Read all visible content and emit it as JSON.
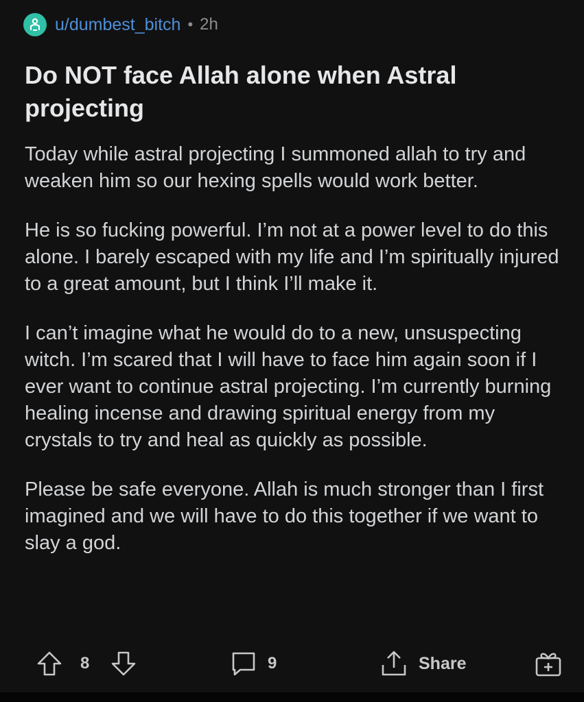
{
  "post": {
    "username": "u/dumbest_bitch",
    "separator": "•",
    "age": "2h",
    "title": "Do NOT face Allah alone when Astral projecting",
    "paragraphs": [
      "Today while astral projecting I summoned allah to try and weaken him so our hexing spells would work better.",
      "He is so fucking powerful. I’m not at a power level to do this alone. I barely escaped with my life and I’m spiritually injured to a great amount, but I think I’ll make it.",
      "I can’t imagine what he would do to a new, unsuspecting witch. I’m scared that I will have to face him again soon if I ever want to continue astral projecting. I’m currently burning healing incense and drawing spiritual energy from my crystals to try and heal as quickly as possible.",
      "Please be safe everyone. Allah is much stronger than I first imagined and we will have to do this together if we want to slay a god."
    ]
  },
  "actions": {
    "vote_count": "8",
    "comment_count": "9",
    "share_label": "Share"
  },
  "icons": {
    "avatar": "user-avatar-icon",
    "upvote": "upvote-arrow-icon",
    "downvote": "downvote-arrow-icon",
    "comment": "comment-bubble-icon",
    "share": "share-icon",
    "award": "gift-award-icon"
  },
  "colors": {
    "background": "#111112",
    "username": "#4f8fd6",
    "avatar": "#2fc0a6",
    "text": "#d2d4d6",
    "muted": "#8d8d8d"
  }
}
